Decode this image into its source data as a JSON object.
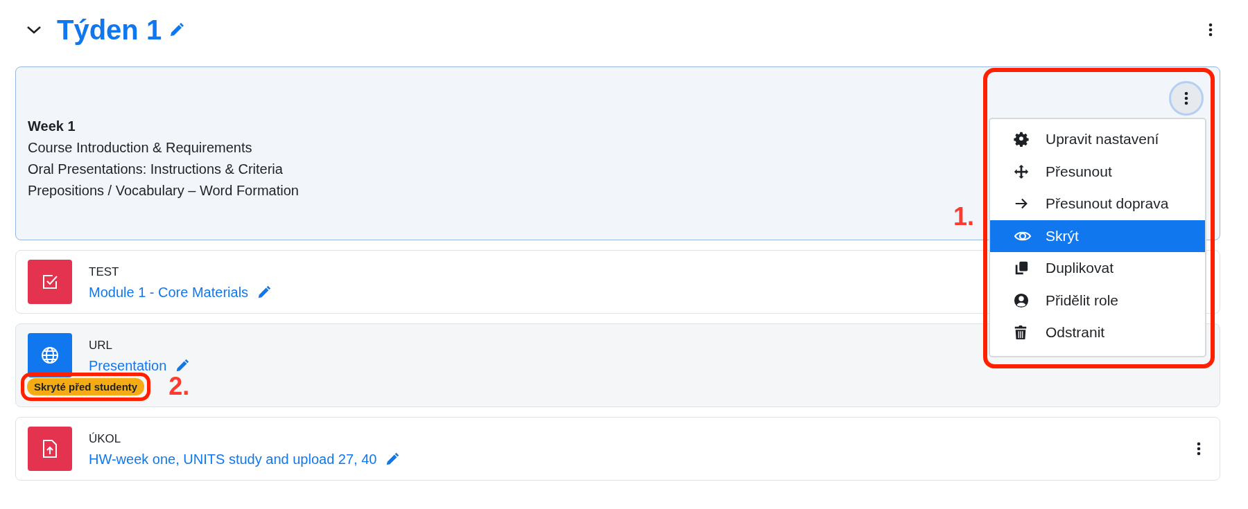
{
  "section": {
    "title": "Týden 1",
    "expanded": true
  },
  "summary": {
    "heading": "Week 1",
    "lines": [
      "Course Introduction & Requirements",
      "Oral Presentations: Instructions & Criteria",
      "Prepositions / Vocabulary – Word Formation"
    ]
  },
  "section_menu": {
    "open": true,
    "items": [
      {
        "label": "Upravit nastavení",
        "kind": "gear",
        "selected": false
      },
      {
        "label": "Přesunout",
        "kind": "move",
        "selected": false
      },
      {
        "label": "Přesunout doprava",
        "kind": "arrow",
        "selected": false
      },
      {
        "label": "Skrýt",
        "kind": "eye",
        "selected": true
      },
      {
        "label": "Duplikovat",
        "kind": "copy",
        "selected": false
      },
      {
        "label": "Přidělit role",
        "kind": "user",
        "selected": false
      },
      {
        "label": "Odstranit",
        "kind": "trash",
        "selected": false
      }
    ]
  },
  "activities": [
    {
      "type": "TEST",
      "kind": "quiz",
      "name": "Module 1 - Core Materials",
      "hidden": false
    },
    {
      "type": "URL",
      "kind": "url",
      "name": "Presentation",
      "hidden": true,
      "badge": "Skryté před studenty"
    },
    {
      "type": "ÚKOL",
      "kind": "assign",
      "name": "HW-week one, UNITS study and upload 27, 40",
      "hidden": false
    }
  ],
  "annotations": [
    "1.",
    "2."
  ]
}
